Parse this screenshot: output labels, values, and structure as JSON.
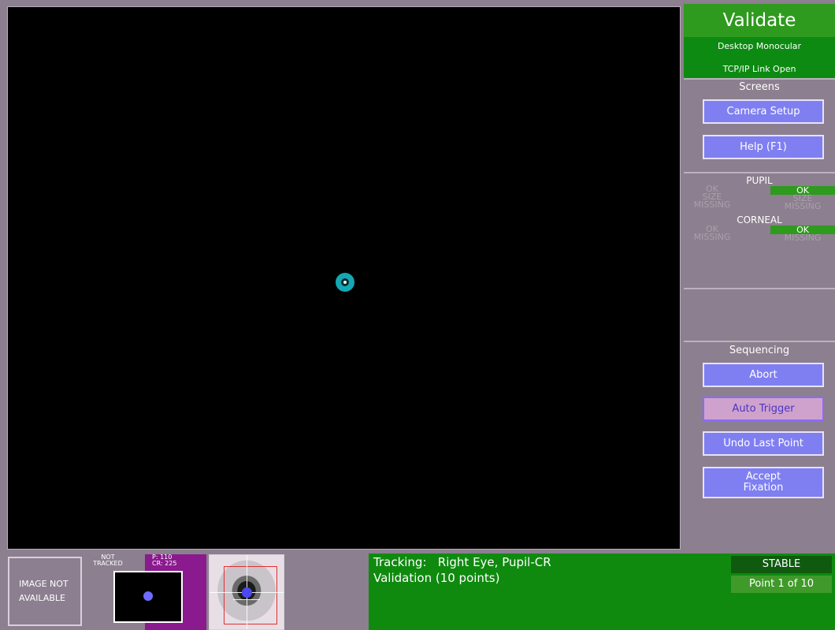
{
  "header": {
    "title": "Validate",
    "mode": "Desktop Monocular",
    "link_status": "TCP/IP Link Open"
  },
  "screens": {
    "title": "Screens",
    "camera_setup": "Camera Setup",
    "help": "Help (F1)"
  },
  "indicators": {
    "pupil_label": "PUPIL",
    "corneal_label": "CORNEAL",
    "ok": "OK",
    "size": "SIZE",
    "missing": "MISSING"
  },
  "sequencing": {
    "title": "Sequencing",
    "abort": "Abort",
    "auto_trigger": "Auto Trigger",
    "undo_last_point": "Undo Last Point",
    "accept_fixation": "Accept Fixation"
  },
  "bottom": {
    "image_not_available": "IMAGE NOT AVAILABLE",
    "not_tracked": "NOT TRACKED",
    "p_value": "P: 110",
    "cr_value": "CR: 225",
    "tracking_line": "Tracking:   Right Eye, Pupil-CR",
    "validation_line": "Validation (10 points)",
    "stable": "STABLE",
    "point_progress": "Point 1 of 10"
  },
  "colors": {
    "panel_bg": "#8c7f8f",
    "title_green": "#2e9a1e",
    "status_green": "#0f8a0f",
    "button_blue": "#7f7ff2",
    "target_cyan": "#13a8b3"
  }
}
